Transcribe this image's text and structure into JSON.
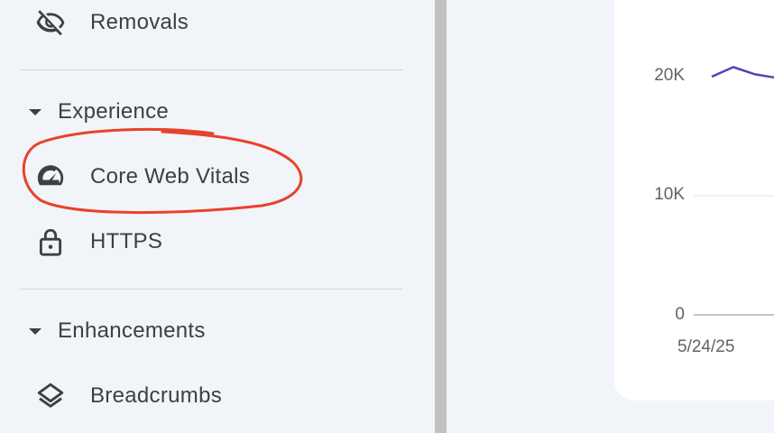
{
  "sidebar": {
    "items": [
      {
        "label": "Removals",
        "icon": "eye-off-icon"
      },
      {
        "label": "Core Web Vitals",
        "icon": "gauge-icon"
      },
      {
        "label": "HTTPS",
        "icon": "lock-icon"
      },
      {
        "label": "Breadcrumbs",
        "icon": "layers-icon"
      }
    ],
    "sections": [
      {
        "label": "Experience",
        "expanded": true
      },
      {
        "label": "Enhancements",
        "expanded": true
      }
    ]
  },
  "chart_data": {
    "type": "line",
    "y_ticks": [
      "20K",
      "10K",
      "0"
    ],
    "x_ticks": [
      "5/24/25"
    ],
    "ylim": [
      0,
      20000
    ],
    "series": [
      {
        "values": [
          20000,
          20800,
          20200,
          19900
        ]
      }
    ],
    "colors": {
      "line": "#5b3fb5",
      "grid": "#e0e0e0"
    }
  },
  "annotation": {
    "color": "#e8422a"
  }
}
